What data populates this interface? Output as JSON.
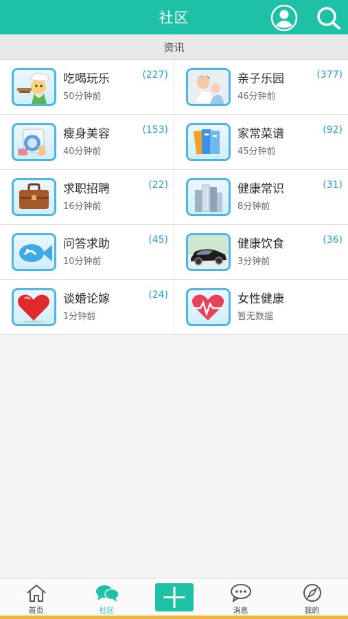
{
  "header": {
    "title": "社区"
  },
  "section": {
    "title": "资讯"
  },
  "categories": [
    {
      "name": "吃喝玩乐",
      "time": "50分钟前",
      "count": "(227)",
      "icon": "chef-icon"
    },
    {
      "name": "亲子乐园",
      "time": "46分钟前",
      "count": "(377)",
      "icon": "family-photo-icon"
    },
    {
      "name": "瘦身美容",
      "time": "40分钟前",
      "count": "(153)",
      "icon": "beauty-icon"
    },
    {
      "name": "家常菜谱",
      "time": "45分钟前",
      "count": "(92)",
      "icon": "books-icon"
    },
    {
      "name": "求职招聘",
      "time": "16分钟前",
      "count": "(22)",
      "icon": "briefcase-icon"
    },
    {
      "name": "健康常识",
      "time": "8分钟前",
      "count": "(31)",
      "icon": "buildings-icon"
    },
    {
      "name": "问答求助",
      "time": "10分钟前",
      "count": "(45)",
      "icon": "fish-icon"
    },
    {
      "name": "健康饮食",
      "time": "3分钟前",
      "count": "(36)",
      "icon": "car-icon"
    },
    {
      "name": "谈婚论嫁",
      "time": "1分钟前",
      "count": "(24)",
      "icon": "heart-icon"
    },
    {
      "name": "女性健康",
      "time": "暂无数据",
      "count": "",
      "icon": "heart-pulse-icon"
    }
  ],
  "tabs": [
    {
      "label": "首页",
      "icon": "home-icon"
    },
    {
      "label": "社区",
      "icon": "chat-bubbles-icon"
    },
    {
      "label": "",
      "icon": "plus-icon"
    },
    {
      "label": "消息",
      "icon": "message-icon"
    },
    {
      "label": "我的",
      "icon": "compass-icon"
    }
  ],
  "colors": {
    "primary": "#1ec0a6",
    "count": "#2a9ad0",
    "thumb_border": "#49b8e8",
    "bottom_strip": "#f0b43a"
  }
}
